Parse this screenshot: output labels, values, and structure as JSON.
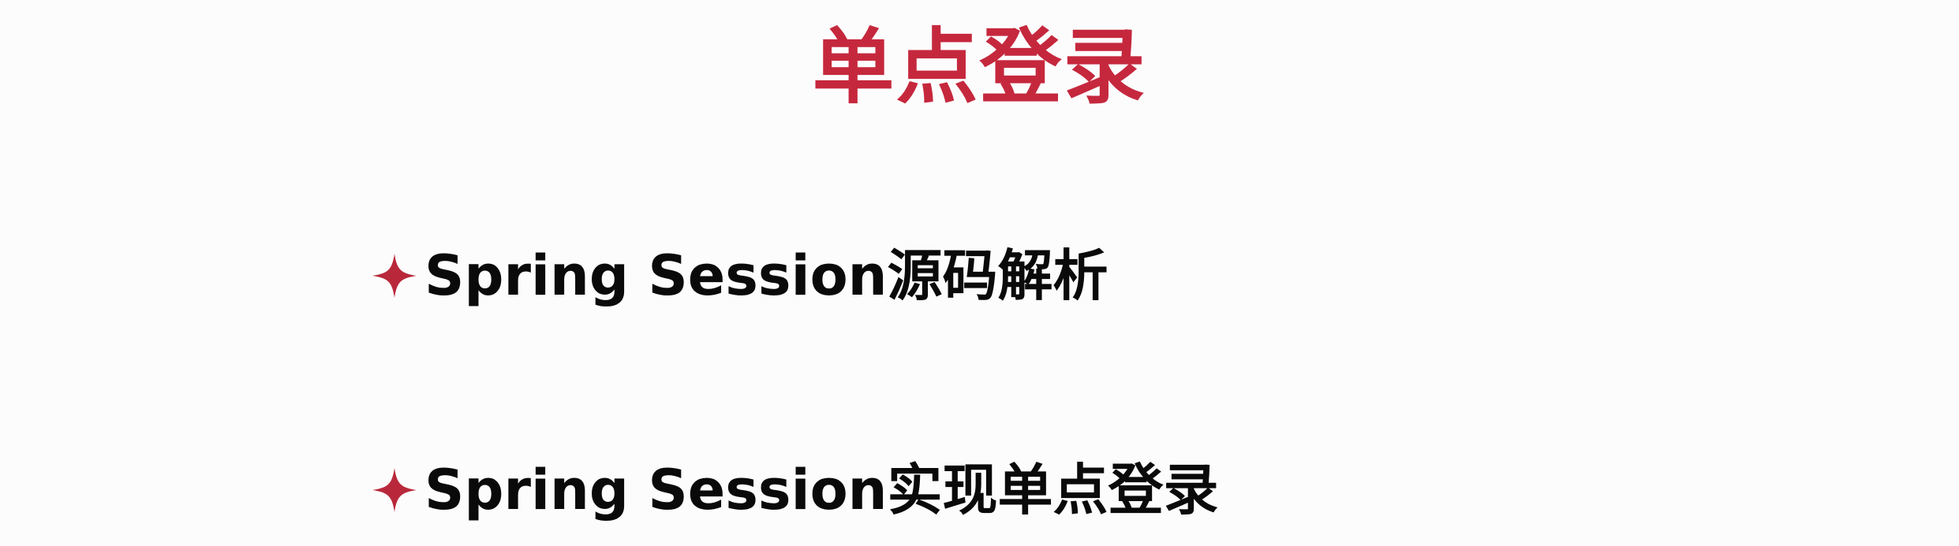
{
  "slide": {
    "title": "单点登录",
    "bullets": [
      {
        "text": "Spring Session源码解析",
        "icon": "four-point-star-icon"
      },
      {
        "text": "Spring Session实现单点登录",
        "icon": "four-point-star-icon"
      }
    ]
  },
  "colors": {
    "title": "#c5283d",
    "bullet_icon": "#b8283a",
    "text": "#0a0a0a",
    "background": "#fdfcfd"
  }
}
